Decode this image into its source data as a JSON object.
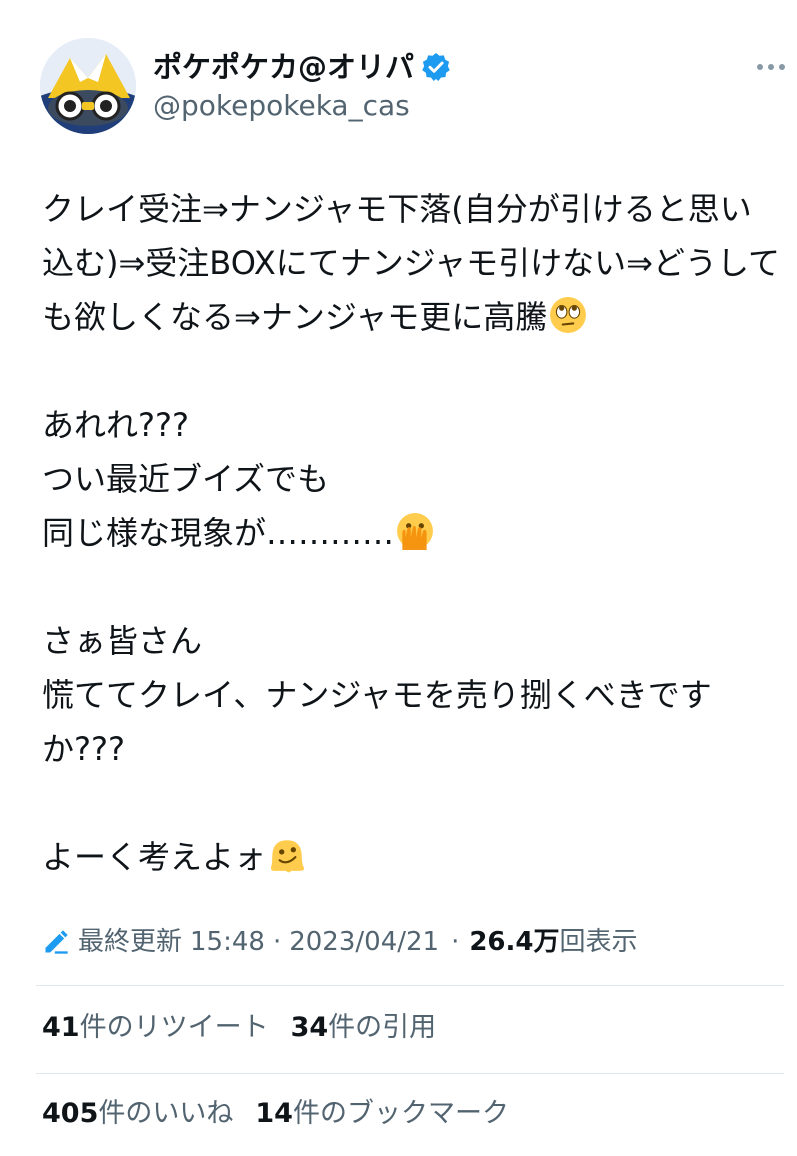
{
  "author": {
    "display_name": "ポケポケカ@オリパ",
    "handle": "@pokepokeka_cas",
    "verified_icon": "verified-badge-icon",
    "avatar_icon": "pokemon-avatar"
  },
  "tweet": {
    "paragraphs": [
      {
        "lines": [
          {
            "text": "クレイ受注⇒ナンジャモ下落(自分が引けると思い込む)⇒受注BOXにてナンジャモ引けない⇒どうしても欲しくなる⇒ナンジャモ更に高騰",
            "emoji": "face-with-rolling-eyes"
          }
        ]
      },
      {
        "lines": [
          {
            "text": "あれれ???",
            "emoji": ""
          },
          {
            "text": "つい最近ブイズでも",
            "emoji": ""
          },
          {
            "text": "同じ様な現象が…………",
            "emoji": "face-with-open-eyes-and-hand-over-mouth"
          }
        ]
      },
      {
        "lines": [
          {
            "text": "さぁ皆さん",
            "emoji": ""
          },
          {
            "text": "慌ててクレイ、ナンジャモを売り捌くべきですか???",
            "emoji": ""
          }
        ]
      },
      {
        "lines": [
          {
            "text": "よーく考えよォ",
            "emoji": "melting-face"
          }
        ]
      }
    ]
  },
  "meta": {
    "edit_icon": "pencil-edit-icon",
    "last_edited_label": "最終更新",
    "time": "15:48",
    "separator": "·",
    "date": "2023/04/21",
    "views_count": "26.4万",
    "views_label": "回表示"
  },
  "stats": {
    "retweets_count": "41",
    "retweets_label": "件のリツイート",
    "quotes_count": "34",
    "quotes_label": "件の引用",
    "likes_count": "405",
    "likes_label": "件のいいね",
    "bookmarks_count": "14",
    "bookmarks_label": "件のブックマーク"
  },
  "colors": {
    "text": "#0f1419",
    "secondary": "#536471",
    "verified_blue": "#1d9bf0",
    "divider": "#e1e6ea"
  }
}
